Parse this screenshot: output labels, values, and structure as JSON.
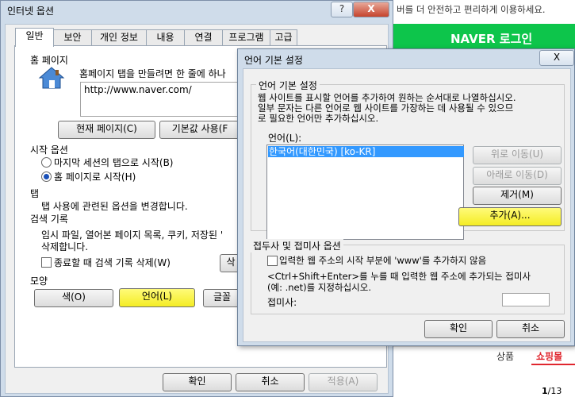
{
  "background": {
    "notice": "버를 더 안전하고 편리하게 이용하세요.",
    "naver_login": "NAVER 로그인",
    "tab_products": "상품",
    "tab_shopping": "쇼핑몰",
    "pager_current": "1",
    "pager_total": "/13"
  },
  "internet_options": {
    "title": "인터넷 옵션",
    "help_btn": "?",
    "close_btn": "X",
    "tabs": [
      "일반",
      "보안",
      "개인 정보",
      "내용",
      "연결",
      "프로그램",
      "고급"
    ],
    "homepage": {
      "heading": "홈 페이지",
      "desc": "홈페이지 탭을 만들려면 한 줄에 하나",
      "url": "http://www.naver.com/",
      "btn_current": "현재 페이지(C)",
      "btn_default": "기본값 사용(F"
    },
    "startup": {
      "heading": "시작 옵션",
      "opt_last_session": "마지막 세션의 탭으로 시작(B)",
      "opt_homepage": "홈 페이지로 시작(H)"
    },
    "tabs_section": {
      "heading": "탭",
      "desc": "탭 사용에 관련된 옵션을 변경합니다."
    },
    "history": {
      "heading": "검색 기록",
      "desc_line1": "임시 파일, 열어본 페이지 목록, 쿠키, 저장된 '",
      "desc_line2": "삭제합니다.",
      "delete_on_exit": "종료할 때 검색 기록 삭제(W)",
      "btn_delete_partial": "삭"
    },
    "appearance": {
      "heading": "모양",
      "btn_colors": "색(O)",
      "btn_languages": "언어(L)",
      "btn_fonts_partial": "글꼴"
    },
    "btn_ok": "확인",
    "btn_cancel": "취소",
    "btn_apply": "적용(A)"
  },
  "language_dialog": {
    "title": "언어 기본 설정",
    "close_btn": "X",
    "group_title": "언어 기본 설정",
    "desc_line1": "웹 사이트를 표시할 언어를 추가하여 원하는 순서대로 나열하십시오.",
    "desc_line2": "일부 문자는 다른 언어로 웹 사이트를 가장하는 데 사용될 수 있으므",
    "desc_line3": "로 필요한 언어만 추가하십시오.",
    "list_label": "언어(L):",
    "languages": [
      "한국어(대한민국) [ko-KR]"
    ],
    "btn_move_up": "위로 이동(U)",
    "btn_move_down": "아래로 이동(D)",
    "btn_remove": "제거(M)",
    "btn_add": "추가(A)...",
    "prefix_group_title": "접두사 및 접미사 옵션",
    "www_checkbox": "입력한 웹 주소의 시작 부분에 'www'를 추가하지 않음",
    "suffix_desc_line1": "<Ctrl+Shift+Enter>를 누를 때 입력한 웹 주소에 추가되는 접미사",
    "suffix_desc_line2": "(예: .net)를 지정하십시오.",
    "suffix_label": "접미사:",
    "suffix_value": "",
    "btn_ok": "확인",
    "btn_cancel": "취소"
  },
  "colors": {
    "highlight": "#f4ec24",
    "naver_green": "#0dc54b",
    "selection_blue": "#3399ff",
    "window_frame": "#cfdcea"
  }
}
